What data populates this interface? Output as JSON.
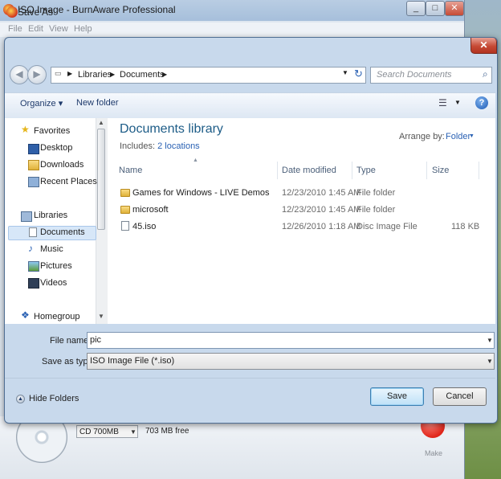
{
  "background_window": {
    "title": "ISO Image - BurnAware Professional",
    "menu": [
      "File",
      "Edit",
      "View",
      "Help"
    ],
    "disc_type": "CD 700MB",
    "free_space": "703 MB free",
    "make_label": "Make",
    "window_buttons": [
      "_",
      "□",
      "✕"
    ]
  },
  "dialog": {
    "title": "Save As",
    "close_label": "✕",
    "breadcrumb": [
      "Libraries",
      "Documents"
    ],
    "search_placeholder": "Search Documents",
    "toolbar": {
      "organize": "Organize ▾",
      "new_folder": "New folder",
      "help": "?"
    },
    "nav": {
      "favorites_header": "Favorites",
      "favorites": [
        "Desktop",
        "Downloads",
        "Recent Places"
      ],
      "libraries_header": "Libraries",
      "libraries": [
        "Documents",
        "Music",
        "Pictures",
        "Videos"
      ],
      "homegroup": "Homegroup",
      "selected": "Documents"
    },
    "library": {
      "title": "Documents library",
      "includes_label": "Includes:",
      "includes_link": "2 locations",
      "arrange_label": "Arrange by:",
      "arrange_value": "Folder"
    },
    "columns": [
      "Name",
      "Date modified",
      "Type",
      "Size"
    ],
    "files": [
      {
        "name": "Games for Windows - LIVE Demos",
        "date": "12/23/2010 1:45 AM",
        "type": "File folder",
        "size": "",
        "icon": "folder-icon"
      },
      {
        "name": "microsoft",
        "date": "12/23/2010 1:45 AM",
        "type": "File folder",
        "size": "",
        "icon": "folder-icon"
      },
      {
        "name": "45.iso",
        "date": "12/26/2010 1:18 AM",
        "type": "Disc Image File",
        "size": "118 KB",
        "icon": "disc-image-icon"
      }
    ],
    "file_name_label": "File name:",
    "file_name_value": "pic",
    "save_type_label": "Save as type:",
    "save_type_value": "ISO Image File (*.iso)",
    "hide_folders": "Hide Folders",
    "save_button": "Save",
    "cancel_button": "Cancel"
  },
  "colors": {
    "accent_link": "#2b62b4",
    "library_title": "#1d5c87",
    "dialog_frame": "#c8d9ec",
    "close_button": "#c64a35"
  }
}
